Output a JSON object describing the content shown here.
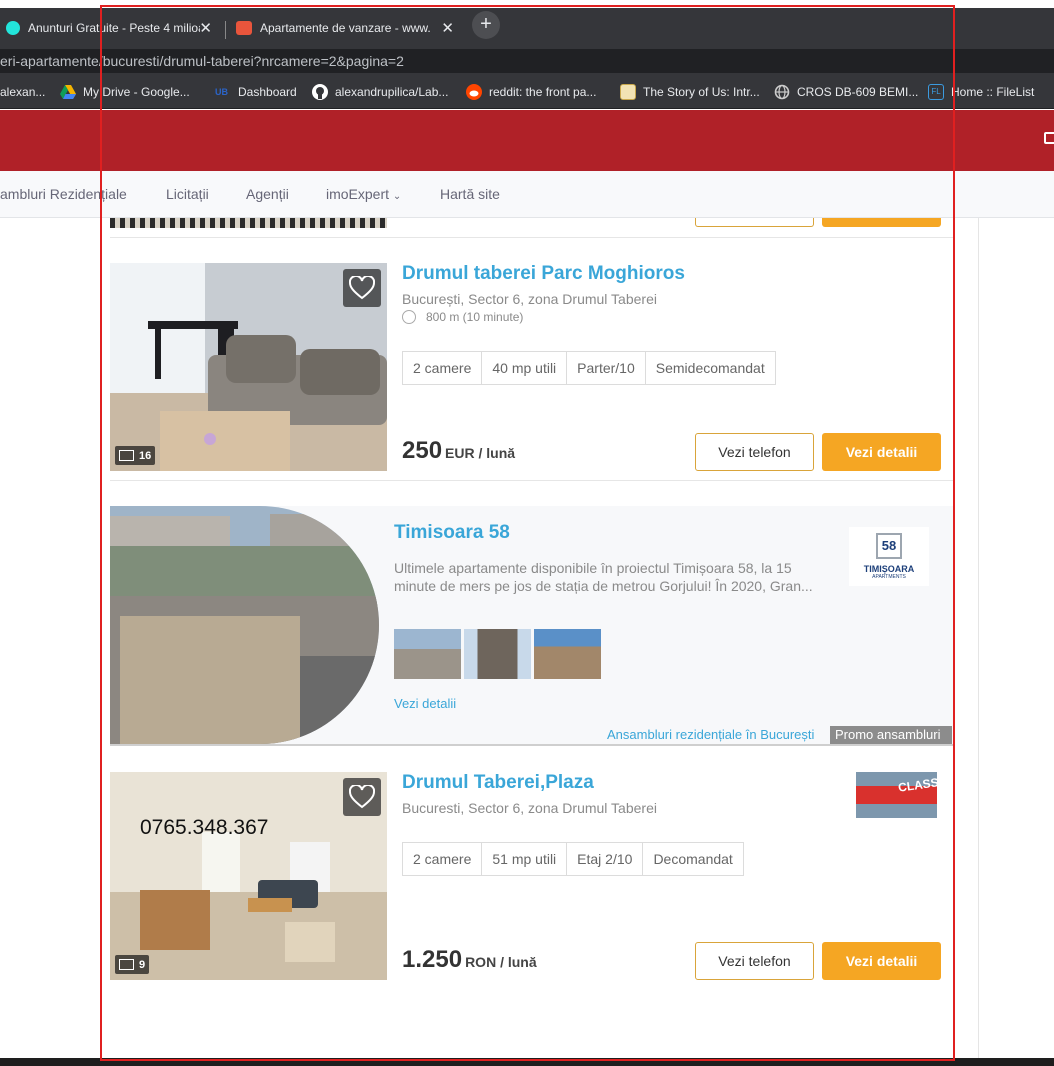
{
  "browser": {
    "tabs": [
      {
        "title": "Anunturi Gratuite - Peste 4 milioa",
        "icon": "olx-icon",
        "color": "#23e5db"
      },
      {
        "title": "Apartamente de vanzare - www.",
        "icon": "imobiliare-icon",
        "color": "#e9553c"
      }
    ],
    "new_tab": "+",
    "url": "eri-apartamente/bucuresti/drumul-taberei?nrcamere=2&pagina=2",
    "bookmarks": [
      {
        "label": "alexan...",
        "icon": "bookmark-icon"
      },
      {
        "label": "My Drive - Google...",
        "icon": "google-drive-icon"
      },
      {
        "label": "Dashboard",
        "icon": "dashboard-icon"
      },
      {
        "label": "alexandrupilica/Lab...",
        "icon": "github-icon"
      },
      {
        "label": "reddit: the front pa...",
        "icon": "reddit-icon"
      },
      {
        "label": "The Story of Us: Intr...",
        "icon": "story-icon"
      },
      {
        "label": "CROS DB-609 BEMI...",
        "icon": "globe-icon"
      },
      {
        "label": "Home :: FileList",
        "icon": "filelist-icon"
      }
    ]
  },
  "site": {
    "header_color": "#b02128",
    "nav": [
      "ambluri Rezidențiale",
      "Licitații",
      "Agenții",
      "imoExpert",
      "Hartă site"
    ],
    "nav_dropdown_arrow": "⌄"
  },
  "listings": [
    {
      "title": "Drumul taberei Parc Moghioros",
      "location": "București, Sector 6, zona Drumul Taberei",
      "distance": "800 m (10 minute)",
      "specs": [
        "2 camere",
        "40 mp utili",
        "Parter/10",
        "Semidecomandat"
      ],
      "price": "250",
      "currency": "EUR / lună",
      "image_count": "16",
      "phone_button": "Vezi telefon",
      "details_button": "Vezi detalii"
    },
    {
      "title": "Drumul Taberei,Plaza",
      "location": "Bucuresti, Sector 6, zona Drumul Taberei",
      "specs": [
        "2 camere",
        "51 mp utili",
        "Etaj 2/10",
        "Decomandat"
      ],
      "price": "1.250",
      "currency": "RON / lună",
      "image_count": "9",
      "phone_overlay": "0765.348.367",
      "agency_sign": "CLASS",
      "phone_button": "Vezi telefon",
      "details_button": "Vezi detalii"
    }
  ],
  "promo": {
    "title": "Timisoara 58",
    "description": "Ultimele apartamente disponibile în proiectul Timișoara 58, la 15 minute de mers pe jos de stația de metrou Gorjului! În 2020, Gran...",
    "link": "Vezi detalii",
    "logo_mark": "58",
    "logo_name": "TIMIȘOARA",
    "logo_sub": "APARTMENTS",
    "footer_link": "Ansambluri rezidențiale în București",
    "badge": "Promo ansambluri"
  },
  "colors": {
    "accent": "#f5a623",
    "link": "#3aa6d8",
    "brand_red": "#b02128"
  }
}
